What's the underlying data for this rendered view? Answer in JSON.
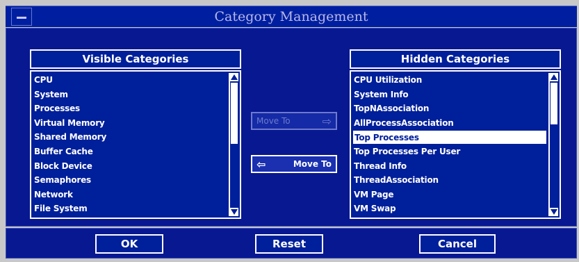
{
  "window": {
    "title": "Category Management"
  },
  "visible": {
    "header": "Visible Categories",
    "items": [
      "CPU",
      "System",
      "Processes",
      "Virtual Memory",
      "Shared Memory",
      "Buffer Cache",
      "Block Device",
      "Semaphores",
      "Network",
      "File System"
    ]
  },
  "hidden": {
    "header": "Hidden Categories",
    "items": [
      "CPU Utilization",
      "System Info",
      "TopNAssociation",
      "AllProcessAssociation",
      "Top Processes",
      "Top Processes Per User",
      "Thread Info",
      "ThreadAssociation",
      "VM Page",
      "VM Swap"
    ],
    "selected_index": 4
  },
  "move_right": {
    "label": "Move To",
    "icon": "arrow-right-icon",
    "enabled": false
  },
  "move_left": {
    "label": "Move To",
    "icon": "arrow-left-icon",
    "enabled": true
  },
  "buttons": {
    "ok": "OK",
    "reset": "Reset",
    "cancel": "Cancel"
  },
  "colors": {
    "background": "#081890",
    "list": "#001f9a",
    "text": "#ffffff",
    "titlebar": "#001fa0"
  }
}
